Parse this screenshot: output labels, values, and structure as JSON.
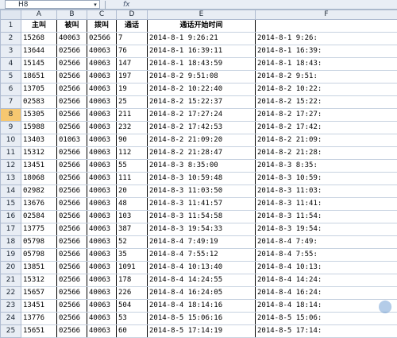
{
  "namebox": {
    "value": "H8",
    "dropdown_icon": "chevron-down-icon"
  },
  "formula": {
    "fx_label": "fx",
    "value": ""
  },
  "columns": [
    "A",
    "B",
    "C",
    "D",
    "E",
    "F"
  ],
  "header_cells": [
    "主叫",
    "被叫",
    "拨叫",
    "通话",
    "通话开始时间",
    ""
  ],
  "selected_row": "8",
  "rows": [
    [
      "2",
      "15268",
      "40063",
      "02566",
      "7",
      "2014-8-1 9:26:21",
      "2014-8-1 9:26:"
    ],
    [
      "3",
      "13644",
      "02566",
      "40063",
      "76",
      "2014-8-1 16:39:11",
      "2014-8-1 16:39:"
    ],
    [
      "4",
      "15145",
      "02566",
      "40063",
      "147",
      "2014-8-1 18:43:59",
      "2014-8-1 18:43:"
    ],
    [
      "5",
      "18651",
      "02566",
      "40063",
      "197",
      "2014-8-2 9:51:08",
      "2014-8-2 9:51:"
    ],
    [
      "6",
      "13705",
      "02566",
      "40063",
      "19",
      "2014-8-2 10:22:40",
      "2014-8-2 10:22:"
    ],
    [
      "7",
      "02583",
      "02566",
      "40063",
      "25",
      "2014-8-2 15:22:37",
      "2014-8-2 15:22:"
    ],
    [
      "8",
      "15305",
      "02566",
      "40063",
      "211",
      "2014-8-2 17:27:24",
      "2014-8-2 17:27:"
    ],
    [
      "9",
      "15988",
      "02566",
      "40063",
      "232",
      "2014-8-2 17:42:53",
      "2014-8-2 17:42:"
    ],
    [
      "10",
      "13403",
      "01063",
      "40063",
      "90",
      "2014-8-2 21:09:20",
      "2014-8-2 21:09:"
    ],
    [
      "11",
      "15312",
      "02566",
      "40063",
      "112",
      "2014-8-2 21:28:47",
      "2014-8-2 21:28:"
    ],
    [
      "12",
      "13451",
      "02566",
      "40063",
      "55",
      "2014-8-3 8:35:00",
      "2014-8-3 8:35:"
    ],
    [
      "13",
      "18068",
      "02566",
      "40063",
      "111",
      "2014-8-3 10:59:48",
      "2014-8-3 10:59:"
    ],
    [
      "14",
      "02982",
      "02566",
      "40063",
      "20",
      "2014-8-3 11:03:50",
      "2014-8-3 11:03:"
    ],
    [
      "15",
      "13676",
      "02566",
      "40063",
      "48",
      "2014-8-3 11:41:57",
      "2014-8-3 11:41:"
    ],
    [
      "16",
      "02584",
      "02566",
      "40063",
      "103",
      "2014-8-3 11:54:58",
      "2014-8-3 11:54:"
    ],
    [
      "17",
      "13775",
      "02566",
      "40063",
      "387",
      "2014-8-3 19:54:33",
      "2014-8-3 19:54:"
    ],
    [
      "18",
      "05798",
      "02566",
      "40063",
      "52",
      "2014-8-4 7:49:19",
      "2014-8-4 7:49:"
    ],
    [
      "19",
      "05798",
      "02566",
      "40063",
      "35",
      "2014-8-4 7:55:12",
      "2014-8-4 7:55:"
    ],
    [
      "20",
      "13851",
      "02566",
      "40063",
      "1091",
      "2014-8-4 10:13:40",
      "2014-8-4 10:13:"
    ],
    [
      "21",
      "15312",
      "02566",
      "40063",
      "178",
      "2014-8-4 14:24:55",
      "2014-8-4 14:24:"
    ],
    [
      "22",
      "15657",
      "02566",
      "40063",
      "226",
      "2014-8-4 16:24:05",
      "2014-8-4 16:24:"
    ],
    [
      "23",
      "13451",
      "02566",
      "40063",
      "504",
      "2014-8-4 18:14:16",
      "2014-8-4 18:14:"
    ],
    [
      "24",
      "13776",
      "02566",
      "40063",
      "53",
      "2014-8-5 15:06:16",
      "2014-8-5 15:06:"
    ],
    [
      "25",
      "15651",
      "02566",
      "40063",
      "60",
      "2014-8-5 17:14:19",
      "2014-8-5 17:14:"
    ]
  ]
}
